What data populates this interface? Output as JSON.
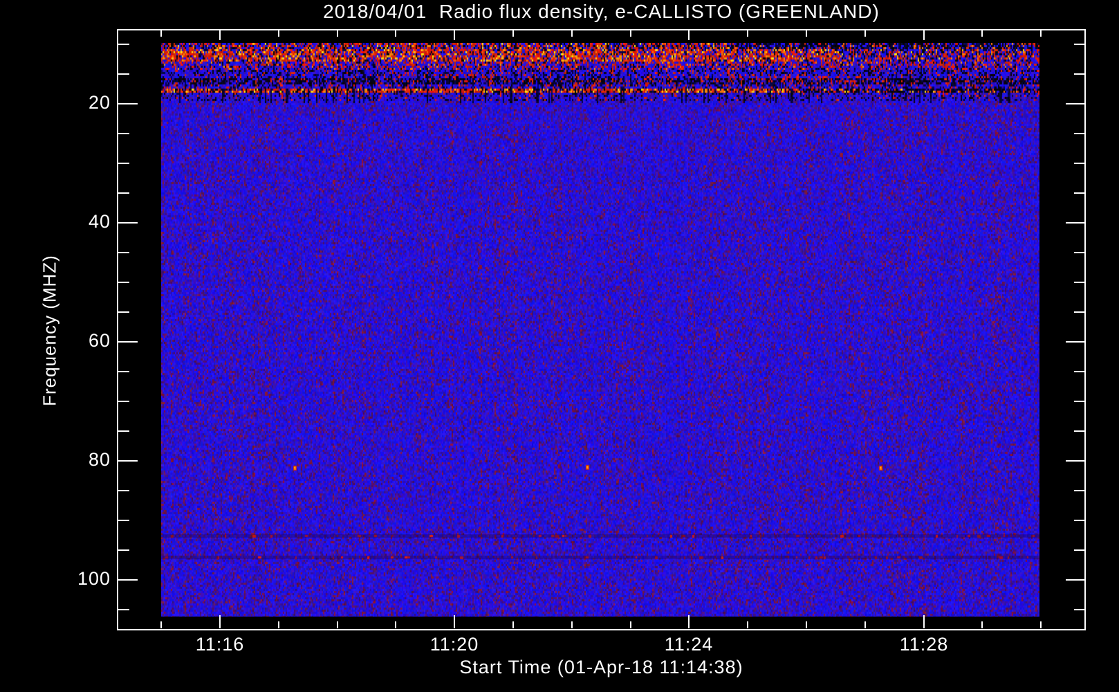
{
  "title": "2018/04/01  Radio flux density, e-CALLISTO (GREENLAND)",
  "chart_data": {
    "type": "heatmap",
    "title": "2018/04/01  Radio flux density, e-CALLISTO (GREENLAND)",
    "xlabel": "Start Time (01-Apr-18 11:14:38)",
    "ylabel": "Frequency (MHZ)",
    "date": "2018/04/01",
    "instrument": "e-CALLISTO (GREENLAND)",
    "start_time": "11:14:38",
    "x_tick_labels": [
      "11:16",
      "11:20",
      "11:24",
      "11:28"
    ],
    "x_major_step_minutes": 4,
    "x_minor_step_minutes": 1,
    "y_tick_labels": [
      "20",
      "40",
      "60",
      "80",
      "100"
    ],
    "y_major_ticks_mhz": [
      20,
      40,
      60,
      80,
      100
    ],
    "y_minor_step_mhz": 5,
    "y_range_mhz": [
      7.5,
      108.5
    ],
    "y_inverted": true,
    "data_freq_span_mhz": [
      10,
      106
    ],
    "data_time_span": [
      "11:15:00",
      "11:30:00"
    ],
    "grid": false,
    "legend": false,
    "bands": [
      {
        "freq_mhz": [
          10.0,
          13.2
        ],
        "intensity": "high",
        "appearance": "dense red-orange RFI speckle with yellow flecks, fading to dark blue at right"
      },
      {
        "freq_mhz": [
          13.2,
          14.5
        ],
        "intensity": "medium",
        "appearance": "mixed red and blue speckle"
      },
      {
        "freq_mhz": [
          14.5,
          15.8
        ],
        "intensity": "low",
        "appearance": "blue with sparse red specks"
      },
      {
        "freq_mhz": [
          15.8,
          17.0
        ],
        "intensity": "dark",
        "appearance": "near-black band with red specks"
      },
      {
        "freq_mhz": [
          17.3,
          17.9
        ],
        "intensity": "high",
        "appearance": "bright narrow red/orange/yellow interference line, darker toward right"
      },
      {
        "freq_mhz": [
          18.5,
          106.0
        ],
        "intensity": "background",
        "appearance": "uniform blue receiver noise with violet mottling"
      },
      {
        "freq_mhz": [
          92.6,
          93.2
        ],
        "intensity": "faint",
        "appearance": "sparse dark-red FM broadcast speckle row"
      },
      {
        "freq_mhz": [
          96.2,
          96.9
        ],
        "intensity": "faint",
        "appearance": "sparse dark-red FM broadcast speckle row"
      }
    ],
    "point_features": [
      {
        "desc": "small orange speck",
        "approx_freq_mhz": 83,
        "approx_time": "11:17:15"
      },
      {
        "desc": "small orange speck",
        "approx_freq_mhz": 83,
        "approx_time": "11:22:15"
      },
      {
        "desc": "small orange speck",
        "approx_freq_mhz": 83,
        "approx_time": "11:27:15"
      }
    ],
    "palette": {
      "blue": "#1a12f0",
      "blue_med": "#3a10b4",
      "violet": "#470d6e",
      "maroon": "#5c1240",
      "dark_red": "#801a30",
      "red": "#d42000",
      "orange": "#ff7700",
      "yellow": "#ffcc00",
      "navy": "#000040",
      "black": "#000000"
    }
  },
  "colors": {
    "background": "#000000",
    "axis": "#ffffff",
    "text": "#ffffff"
  }
}
